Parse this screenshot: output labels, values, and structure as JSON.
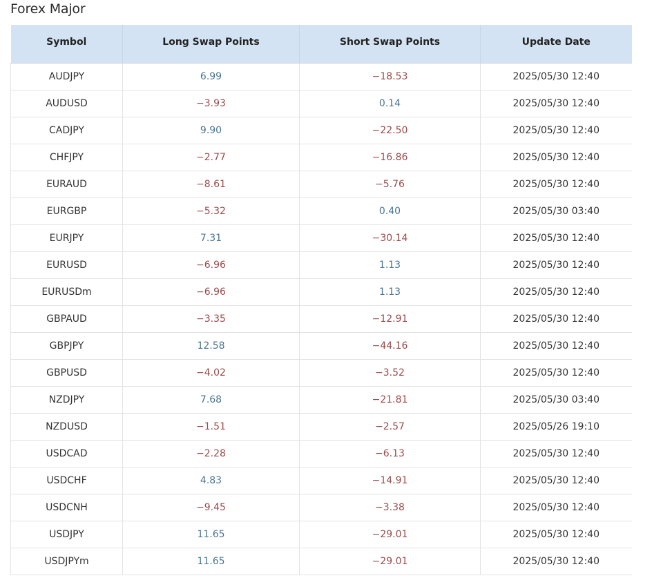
{
  "section": {
    "title": "Forex Major"
  },
  "table": {
    "headers": {
      "symbol": "Symbol",
      "long": "Long Swap Points",
      "short": "Short Swap Points",
      "date": "Update Date"
    },
    "colors": {
      "positive": "#4a7593",
      "negative": "#9c4a4a",
      "header_bg": "#d4e3f3"
    },
    "rows": [
      {
        "symbol": "AUDJPY",
        "long": "6.99",
        "short": "-18.53",
        "date": "2025/05/30 12:40"
      },
      {
        "symbol": "AUDUSD",
        "long": "-3.93",
        "short": "0.14",
        "date": "2025/05/30 12:40"
      },
      {
        "symbol": "CADJPY",
        "long": "9.90",
        "short": "-22.50",
        "date": "2025/05/30 12:40"
      },
      {
        "symbol": "CHFJPY",
        "long": "-2.77",
        "short": "-16.86",
        "date": "2025/05/30 12:40"
      },
      {
        "symbol": "EURAUD",
        "long": "-8.61",
        "short": "-5.76",
        "date": "2025/05/30 12:40"
      },
      {
        "symbol": "EURGBP",
        "long": "-5.32",
        "short": "0.40",
        "date": "2025/05/30 03:40"
      },
      {
        "symbol": "EURJPY",
        "long": "7.31",
        "short": "-30.14",
        "date": "2025/05/30 12:40"
      },
      {
        "symbol": "EURUSD",
        "long": "-6.96",
        "short": "1.13",
        "date": "2025/05/30 12:40"
      },
      {
        "symbol": "EURUSDm",
        "long": "-6.96",
        "short": "1.13",
        "date": "2025/05/30 12:40"
      },
      {
        "symbol": "GBPAUD",
        "long": "-3.35",
        "short": "-12.91",
        "date": "2025/05/30 12:40"
      },
      {
        "symbol": "GBPJPY",
        "long": "12.58",
        "short": "-44.16",
        "date": "2025/05/30 12:40"
      },
      {
        "symbol": "GBPUSD",
        "long": "-4.02",
        "short": "-3.52",
        "date": "2025/05/30 12:40"
      },
      {
        "symbol": "NZDJPY",
        "long": "7.68",
        "short": "-21.81",
        "date": "2025/05/30 03:40"
      },
      {
        "symbol": "NZDUSD",
        "long": "-1.51",
        "short": "-2.57",
        "date": "2025/05/26 19:10"
      },
      {
        "symbol": "USDCAD",
        "long": "-2.28",
        "short": "-6.13",
        "date": "2025/05/30 12:40"
      },
      {
        "symbol": "USDCHF",
        "long": "4.83",
        "short": "-14.91",
        "date": "2025/05/30 12:40"
      },
      {
        "symbol": "USDCNH",
        "long": "-9.45",
        "short": "-3.38",
        "date": "2025/05/30 12:40"
      },
      {
        "symbol": "USDJPY",
        "long": "11.65",
        "short": "-29.01",
        "date": "2025/05/30 12:40"
      },
      {
        "symbol": "USDJPYm",
        "long": "11.65",
        "short": "-29.01",
        "date": "2025/05/30 12:40"
      }
    ]
  }
}
